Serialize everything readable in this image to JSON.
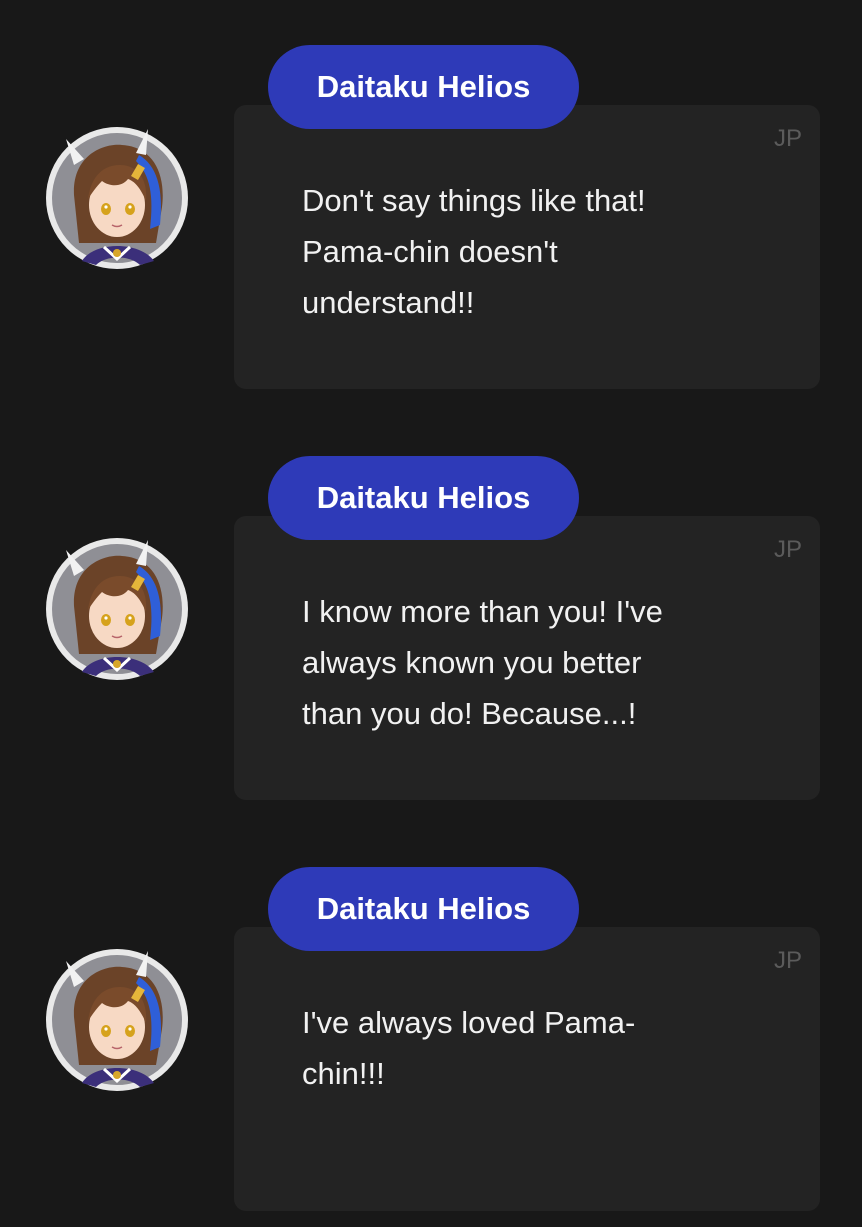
{
  "messages": [
    {
      "speaker": "Daitaku Helios",
      "lang": "JP",
      "text": "Don't say things like that!\nPama-chin doesn't\nunderstand!!"
    },
    {
      "speaker": "Daitaku Helios",
      "lang": "JP",
      "text": "I know more than you! I've\nalways known you better\nthan you do! Because...!"
    },
    {
      "speaker": "Daitaku Helios",
      "lang": "JP",
      "text": "I've always loved Pama-\nchin!!!"
    }
  ],
  "colors": {
    "background": "#181818",
    "bubble": "#232323",
    "name_tag": "#2e3ab8",
    "lang_label": "#5b5b5b",
    "text": "#f1f1f1"
  },
  "icons": {
    "avatar": "character-avatar-daitaku-helios"
  }
}
